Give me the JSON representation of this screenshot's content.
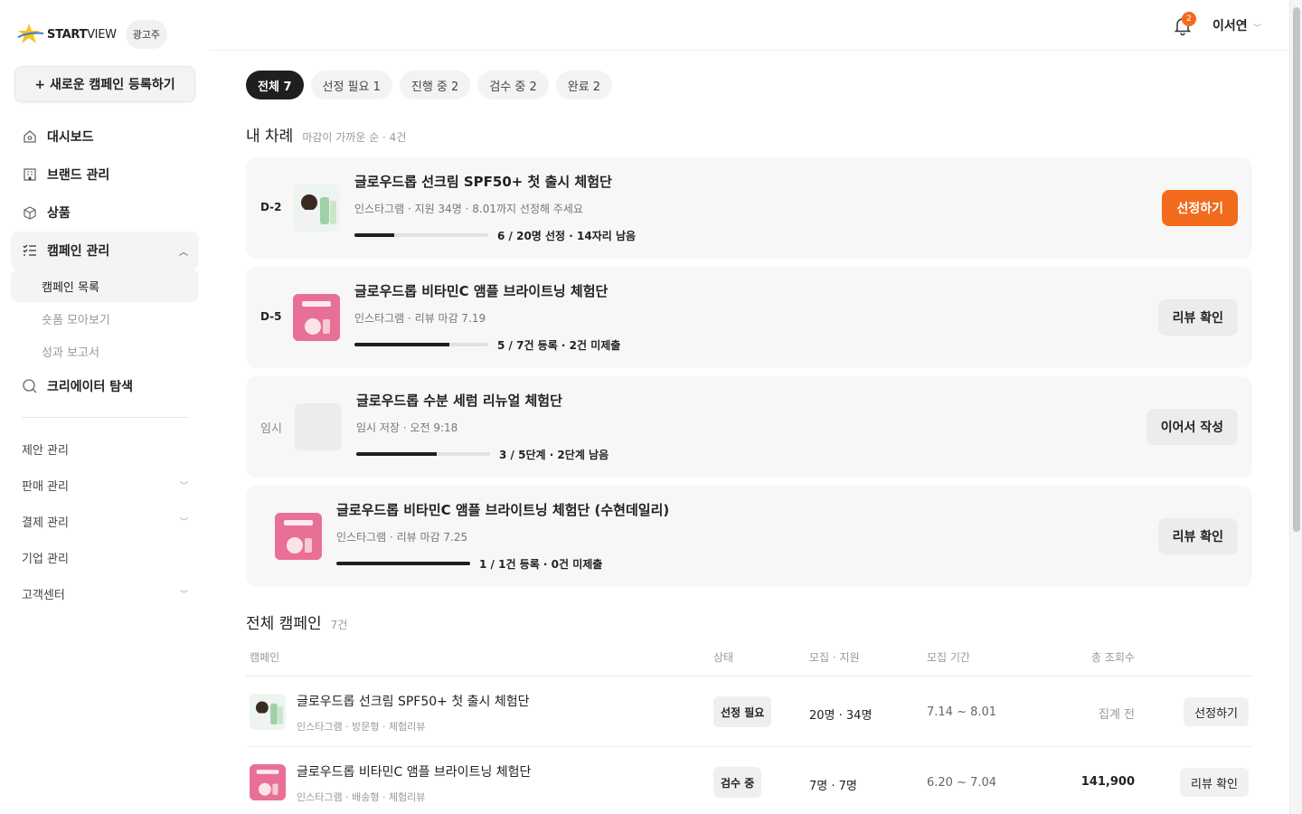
{
  "brand": {
    "logo_bold": "START",
    "logo_light": "VIEW",
    "role": "광고주",
    "accent": "#f26b1d"
  },
  "sidebar": {
    "new_campaign": "+ 새로운 캠페인 등록하기",
    "items": [
      {
        "label": "대시보드",
        "icon": "home-icon"
      },
      {
        "label": "브랜드 관리",
        "icon": "building-icon"
      },
      {
        "label": "상품",
        "icon": "box-icon"
      },
      {
        "label": "캠페인 관리",
        "icon": "list-icon"
      },
      {
        "label": "크리에이터 탐색",
        "icon": "search-icon"
      }
    ],
    "sub_items": [
      "캠페인 목록",
      "숏폼 모아보기",
      "성과 보고서"
    ],
    "secondary": [
      "제안 관리",
      "판매 관리",
      "결제 관리",
      "기업 관리",
      "고객센터"
    ]
  },
  "topbar": {
    "notif_count": "2",
    "user_name": "이서연"
  },
  "filters": [
    "전체 7",
    "선정 필요 1",
    "진행 중 2",
    "검수 중 2",
    "완료 2"
  ],
  "my_turn": {
    "title": "내 차례",
    "meta": "마감이 가까운 순 · 4건",
    "cards": [
      {
        "dday": "D-2",
        "title": "글로우드롭 선크림 SPF50+ 첫 출시 체험단",
        "sub": "인스타그램 · 지원 34명 · 8.01까지 선정해 주세요",
        "progress_text": "6 / 20명 선정 · 14자리 남음",
        "progress": 0.3,
        "cta": "선정하기"
      },
      {
        "dday": "D-5",
        "title": "글로우드롭 비타민C 앰플 브라이트닝 체험단",
        "sub": "인스타그램 · 리뷰 마감 7.19",
        "progress_text": "5 / 7건 등록 · 2건 미제출",
        "progress": 0.71,
        "cta": "리뷰 확인"
      },
      {
        "dday": "임시",
        "title": "글로우드롭 수분 세럼 리뉴얼 체험단",
        "sub": "임시 저장 · 오전 9:18",
        "progress_text": "3 / 5단계 · 2단계 남음",
        "progress": 0.6,
        "cta": "이어서 작성"
      },
      {
        "dday": "",
        "title": "글로우드롭 비타민C 앰플 브라이트닝 체험단 (수현데일리)",
        "sub": "인스타그램 · 리뷰 마감 7.25",
        "progress_text": "1 / 1건 등록 · 0건 미제출",
        "progress": 1.0,
        "cta": "리뷰 확인"
      }
    ]
  },
  "all_campaigns": {
    "title": "전체 캠페인",
    "count": "7건",
    "headers": [
      "캠페인",
      "상태",
      "모집 · 지원",
      "모집 기간",
      "총 조회수"
    ],
    "rows": [
      {
        "title": "글로우드롭 선크림 SPF50+ 첫 출시 체험단",
        "sub": "인스타그램 · 방문형 · 체험리뷰",
        "status": "선정 필요",
        "recruit": "20명 · 34명",
        "period": "7.14 ~ 8.01",
        "views": "집계 전",
        "action": "선정하기"
      },
      {
        "title": "글로우드롭 비타민C 앰플 브라이트닝 체험단",
        "sub": "인스타그램 · 배송형 · 체험리뷰",
        "status": "검수 중",
        "recruit": "7명 · 7명",
        "period": "6.20 ~ 7.04",
        "views": "141,900",
        "action": "리뷰 확인"
      }
    ]
  }
}
